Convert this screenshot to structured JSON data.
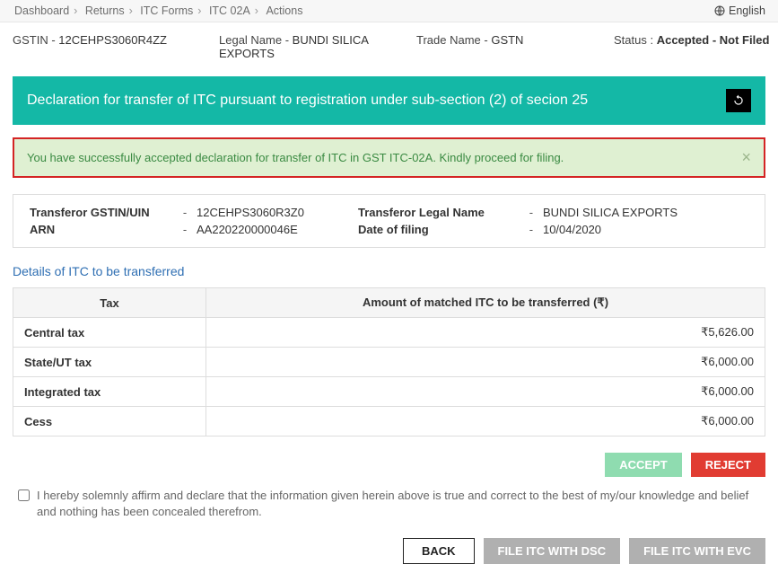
{
  "breadcrumb": {
    "items": [
      "Dashboard",
      "Returns",
      "ITC Forms",
      "ITC 02A",
      "Actions"
    ]
  },
  "language": "English",
  "header": {
    "gstin_label": "GSTIN - ",
    "gstin_value": "12CEHPS3060R4ZZ",
    "legal_name_label": "Legal Name - ",
    "legal_name_value": "BUNDI SILICA EXPORTS",
    "trade_name_label": "Trade Name - ",
    "trade_name_value": "GSTN",
    "status_label": "Status : ",
    "status_value": "Accepted - Not Filed"
  },
  "banner": {
    "title": "Declaration for transfer of ITC pursuant to registration under sub-section (2) of secion 25"
  },
  "alert": {
    "text": "You have successfully accepted declaration for transfer of ITC in GST ITC-02A. Kindly proceed for filing."
  },
  "transferor": {
    "gstin_label": "Transferor GSTIN/UIN",
    "gstin_value": "12CEHPS3060R3Z0",
    "arn_label": "ARN",
    "arn_value": "AA220220000046E",
    "legal_name_label": "Transferor Legal Name",
    "legal_name_value": "BUNDI SILICA EXPORTS",
    "date_label": "Date of filing",
    "date_value": "10/04/2020"
  },
  "section_title": "Details of ITC to be transferred",
  "table": {
    "col_tax": "Tax",
    "col_amount": "Amount of matched ITC to be transferred (₹)",
    "rows": [
      {
        "tax": "Central tax",
        "amount": "₹5,626.00"
      },
      {
        "tax": "State/UT tax",
        "amount": "₹6,000.00"
      },
      {
        "tax": "Integrated tax",
        "amount": "₹6,000.00"
      },
      {
        "tax": "Cess",
        "amount": "₹6,000.00"
      }
    ]
  },
  "buttons": {
    "accept": "ACCEPT",
    "reject": "REJECT",
    "back": "BACK",
    "file_dsc": "FILE ITC WITH DSC",
    "file_evc": "FILE ITC WITH EVC"
  },
  "affirmation": "I hereby solemnly affirm and declare that the information given herein above is true and correct to the best of my/our knowledge and belief and nothing has been concealed therefrom."
}
